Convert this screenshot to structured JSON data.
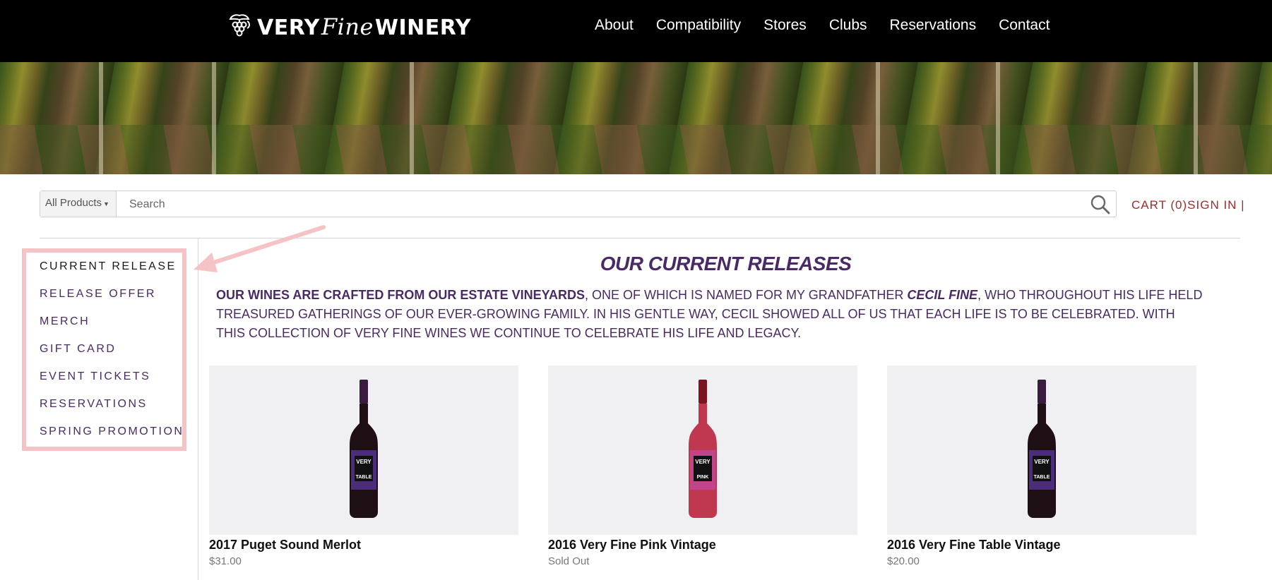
{
  "header": {
    "brand_part1": "VERY",
    "brand_part2": "Fine",
    "brand_part3": "WINERY",
    "nav": [
      "About",
      "Compatibility",
      "Stores",
      "Clubs",
      "Reservations",
      "Contact"
    ]
  },
  "search": {
    "scope": "All Products",
    "placeholder": "Search"
  },
  "account": {
    "cart": "CART (0)",
    "signin": "SIGN IN |"
  },
  "sidebar": {
    "items": [
      {
        "label": "CURRENT RELEASE",
        "active": true
      },
      {
        "label": "RELEASE OFFER",
        "active": false
      },
      {
        "label": "MERCH",
        "active": false
      },
      {
        "label": "GIFT CARD",
        "active": false
      },
      {
        "label": "EVENT TICKETS",
        "active": false
      },
      {
        "label": "RESERVATIONS",
        "active": false
      },
      {
        "label": "SPRING PROMOTION",
        "active": false
      }
    ]
  },
  "main": {
    "title": "OUR CURRENT RELEASES",
    "intro_bold1": "OUR WINES ARE CRAFTED FROM OUR ESTATE VINEYARDS",
    "intro_part2": ", ONE OF WHICH IS NAMED FOR MY GRANDFATHER ",
    "intro_bold2": "CECIL FINE",
    "intro_part3": ", WHO THROUGHOUT HIS LIFE HELD TREASURED GATHERINGS OF OUR EVER-GROWING FAMILY. IN HIS GENTLE WAY, CECIL SHOWED ALL OF US THAT EACH LIFE IS TO BE CELEBRATED. WITH THIS COLLECTION OF VERY FINE WINES WE CONTINUE TO CELEBRATE HIS LIFE AND LEGACY."
  },
  "products": [
    {
      "name": "2017 Puget Sound Merlot",
      "price": "$31.00",
      "label_top": "VERY",
      "label_bottom": "TABLE",
      "wine_color": "#1e0f14",
      "label_color": "#4b2d7a"
    },
    {
      "name": "2016 Very Fine Pink Vintage",
      "price": "Sold Out",
      "label_top": "VERY",
      "label_bottom": "PINK",
      "wine_color": "#c0384f",
      "label_color": "#c0458a"
    },
    {
      "name": "2016 Very Fine Table Vintage",
      "price": "$20.00",
      "label_top": "VERY",
      "label_bottom": "TABLE",
      "wine_color": "#1e0f14",
      "label_color": "#4b2d7a"
    }
  ],
  "colors": {
    "accent_purple": "#4a2a66",
    "cart_red": "#a52a2a",
    "annotation_pink": "#f5c3c6"
  }
}
